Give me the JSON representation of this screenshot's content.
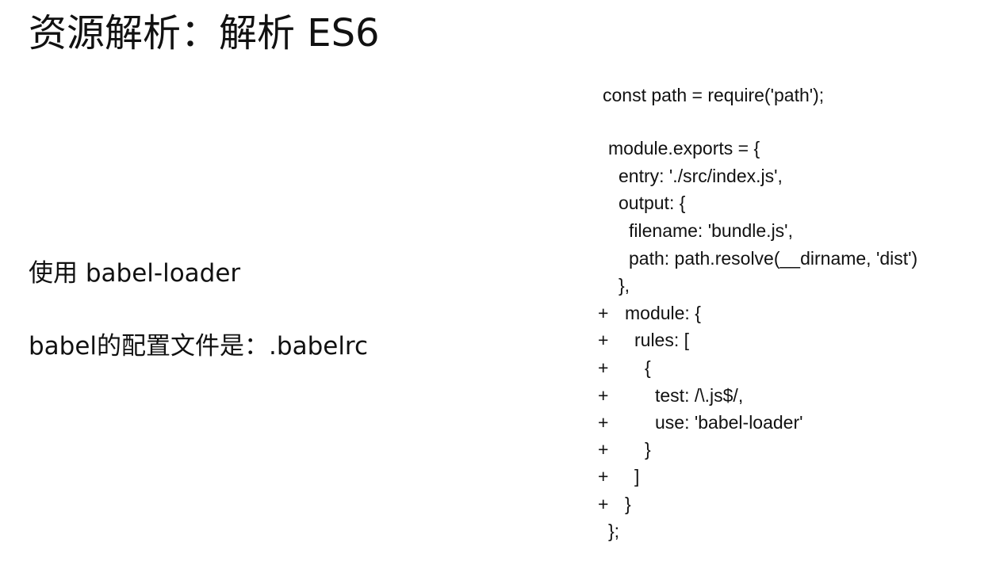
{
  "slide": {
    "title": "资源解析：解析 ES6",
    "bullets": [
      "使用 babel-loader",
      "babel的配置文件是：.babelrc"
    ]
  },
  "code": {
    "plus": "+",
    "lines": [
      "const path = require('path');",
      "module.exports = {",
      "entry: './src/index.js',",
      "output: {",
      "filename: 'bundle.js',",
      "path: path.resolve(__dirname, 'dist')",
      "},",
      "module: {",
      "rules: [",
      "{",
      "test: /\\.js$/,",
      "use: 'babel-loader'",
      "}",
      "]",
      "}",
      "};"
    ]
  }
}
